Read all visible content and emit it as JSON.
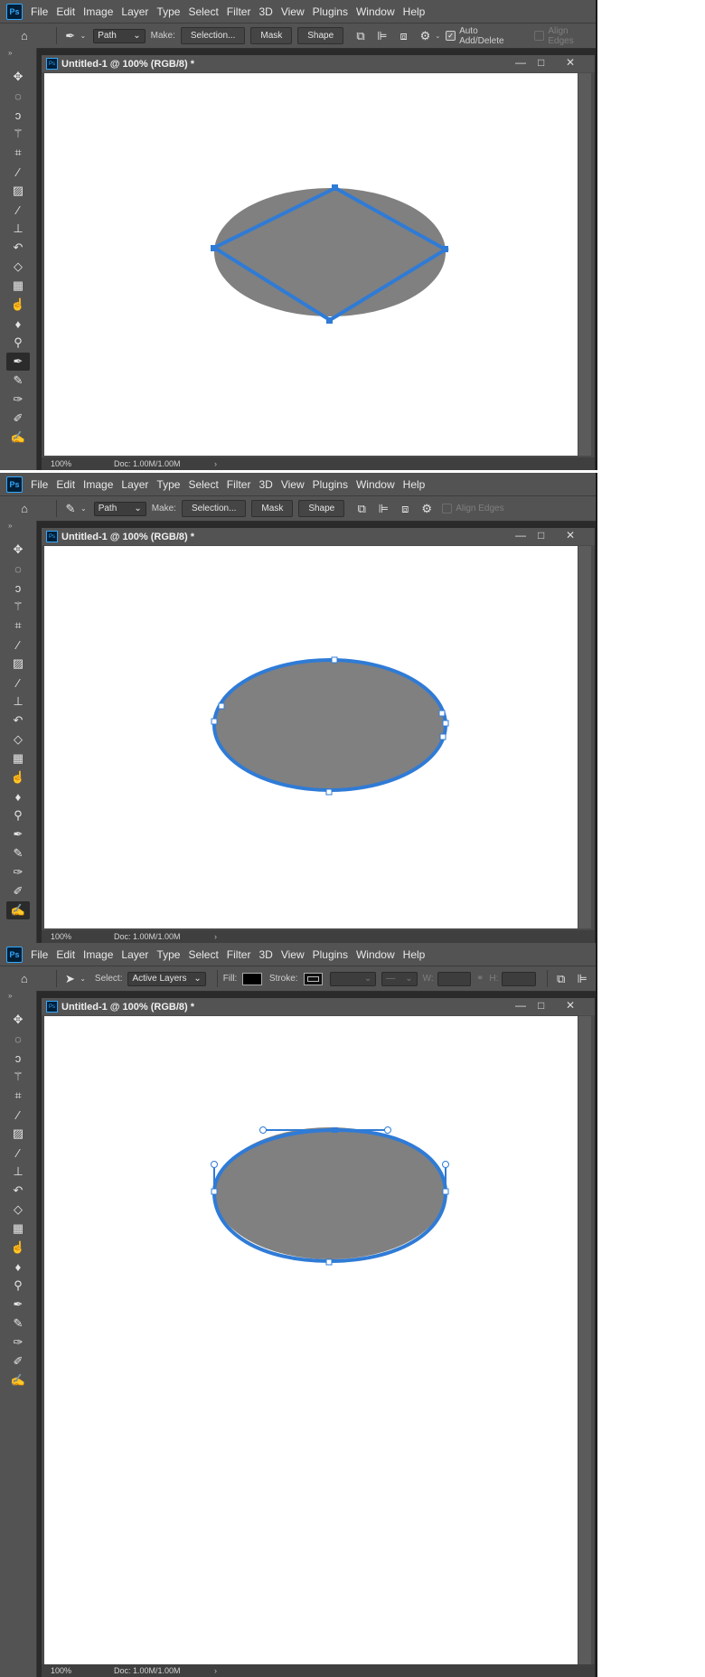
{
  "app_logo": "Ps",
  "menu": [
    "File",
    "Edit",
    "Image",
    "Layer",
    "Type",
    "Select",
    "Filter",
    "3D",
    "View",
    "Plugins",
    "Window",
    "Help"
  ],
  "document": {
    "title": "Untitled-1 @ 100% (RGB/8) *",
    "zoom": "100%",
    "doc_info": "Doc: 1.00M/1.00M"
  },
  "accent_color": "#2f7bd6",
  "shape_fill": "#808080",
  "panel_bg": "#535353",
  "options": {
    "mode": "Path",
    "make_label": "Make:",
    "selection_btn": "Selection...",
    "mask_btn": "Mask",
    "shape_btn": "Shape",
    "auto_add_delete": "Auto Add/Delete",
    "align_edges": "Align Edges"
  },
  "select_options": {
    "select_label": "Select:",
    "select_value": "Active Layers",
    "fill_label": "Fill:",
    "stroke_label": "Stroke:",
    "w_label": "W:",
    "h_label": "H:"
  },
  "tools": [
    "move-icon",
    "ellipse-marquee-icon",
    "lasso-icon",
    "magic-wand-icon",
    "crop-icon",
    "eyedropper-icon",
    "healing-icon",
    "brush-icon",
    "stamp-icon",
    "history-brush-icon",
    "eraser-icon",
    "gradient-icon",
    "smudge-icon",
    "blur-icon",
    "dodge-icon",
    "pen-icon",
    "freeform-pen-icon",
    "add-anchor-icon",
    "delete-anchor-icon",
    "convert-point-icon"
  ],
  "panels": [
    {
      "tool_option": "pen",
      "active_tool": "pen-icon",
      "path": "diamond"
    },
    {
      "tool_option": "freeform-pen",
      "active_tool": "convert-point-icon",
      "path": "ellipse-points"
    },
    {
      "tool_option": "path-select",
      "active_tool": "none",
      "path": "ellipse-handles"
    }
  ]
}
